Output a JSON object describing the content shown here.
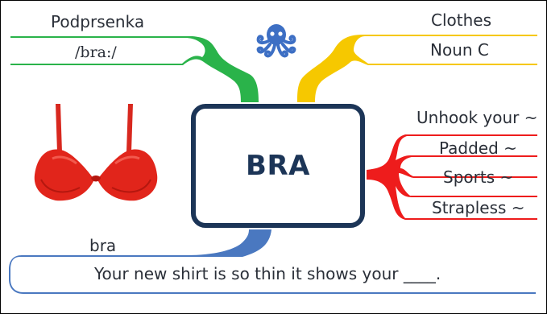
{
  "center": {
    "word": "BRA"
  },
  "left_branch": {
    "translation": "Podprsenka",
    "pronunciation": "/bra:/"
  },
  "right_top_branch": {
    "category": "Clothes",
    "grammar": "Noun C"
  },
  "collocations": [
    "Unhook your ~",
    "Padded ~",
    "Sports ~",
    "Strapless ~"
  ],
  "bottom_branch": {
    "word": "bra",
    "sentence": "Your new shirt is so thin it shows your ____."
  },
  "colors": {
    "green": "#2ab34a",
    "yellow": "#f6c800",
    "red": "#ee1c1c",
    "blue": "#4a78c0",
    "navy": "#1c3557",
    "logo": "#3d6fc4"
  },
  "icons": {
    "logo": "octopus-icon",
    "image": "bra-illustration"
  }
}
